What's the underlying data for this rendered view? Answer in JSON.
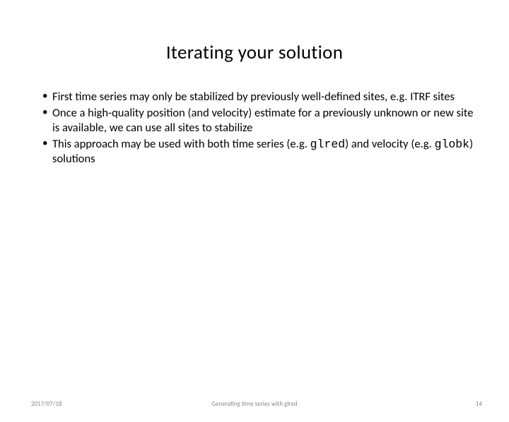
{
  "title": "Iterating your solution",
  "bullets": [
    {
      "pre": "First time series may only be stabilized by previously well-defined sites, e.g. ITRF sites",
      "code1": "",
      "mid": "",
      "code2": "",
      "post": ""
    },
    {
      "pre": "Once a high-quality position (and velocity) estimate for a previously unknown or new site is available, we can use all sites to stabilize",
      "code1": "",
      "mid": "",
      "code2": "",
      "post": ""
    },
    {
      "pre": "This approach may be used with both time series (e.g. ",
      "code1": "glred",
      "mid": ") and velocity (e.g. ",
      "code2": "globk",
      "post": ") solutions"
    }
  ],
  "footer": {
    "date": "2017/07/18",
    "center": "Generating time series with glred",
    "page": "14"
  }
}
